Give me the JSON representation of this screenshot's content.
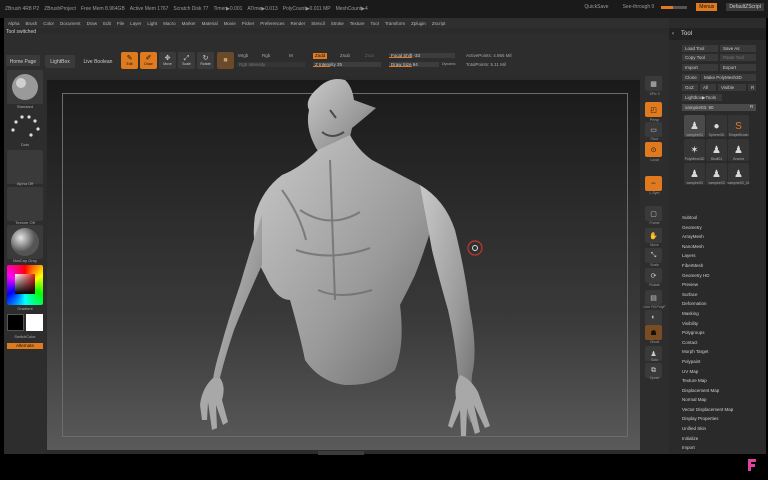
{
  "titlebar": {
    "app": "ZBrush 4R8 P2",
    "project": "ZBrushProject",
    "free_mem": "Free Mem 8.964GB",
    "active_mem": "Active Mem 1767",
    "scratch": "Scratch Disk 77",
    "timer": "Timer▶0.001",
    "atime": "ATime▶0.013",
    "polycount": "PolyCount▶0.011 MP",
    "meshcount": "MeshCount▶4"
  },
  "topright": {
    "quicksave": "QuickSave",
    "see_through": "See-through 0",
    "menus": "Menus",
    "default_zscript": "DefaultZScript"
  },
  "menubar": [
    "Alpha",
    "Brush",
    "Color",
    "Document",
    "Draw",
    "Edit",
    "File",
    "Layer",
    "Light",
    "Macro",
    "Marker",
    "Material",
    "Movie",
    "Picker",
    "Preferences",
    "Render",
    "Stencil",
    "Stroke",
    "Texture",
    "Tool",
    "Transform",
    "Zplugin",
    "Zscript"
  ],
  "status": {
    "message": "Tool switched"
  },
  "toolbar": {
    "home_page": "Home Page",
    "lightbox": "LightBox",
    "live_boolean": "Live Boolean",
    "edit": "Edit",
    "draw": "Draw",
    "move": "Move",
    "scale": "Scale",
    "rotate": "Rotate",
    "mrgb": "Mrgb",
    "rgb": "Rgb",
    "m": "M",
    "rgb_intensity": "Rgb Intensity",
    "zadd": "Zadd",
    "zsub": "Zsub",
    "zcut": "Zcut",
    "z_intensity": "Z Intensity 25",
    "focal_shift": "Focal Shift -33",
    "draw_size": "Draw Size 64",
    "dynamic": "Dynamic",
    "active_points": "ActivePoints: 4.956 Mil",
    "total_points": "TotalPoints: 5.11 Mil"
  },
  "leftpanel": {
    "standard": "Standard",
    "dots": "Dots",
    "alpha_off": "Alpha Off",
    "texture_off": "Texture Off",
    "matcap": "MatCap Gray",
    "gradient": "Gradient",
    "switch_color": "SwitchColor",
    "alternate": "Alternate"
  },
  "rightstrip": [
    "SPix 3",
    "Persp",
    "Floor",
    "Local",
    "L.Sym",
    "Frame",
    "Move",
    "Scale",
    "Rotate",
    "Line Fill PolyF",
    "Transp",
    "Ghost",
    "Solo",
    "Xpose"
  ],
  "toolpanel": {
    "title": "Tool",
    "load_tool": "Load Tool",
    "save_as": "Save As",
    "copy_tool": "Copy Tool",
    "paste_tool": "Paste Tool",
    "import": "Import",
    "export": "Export",
    "clone": "Clone",
    "make_polymesh": "Make PolyMesh3D",
    "goz": "GoZ",
    "all": "All",
    "visible": "Visible",
    "r": "R",
    "lightbox_tools": "Lightbox▶Tools",
    "current_tool": "vampire03. 90",
    "thumbs": [
      {
        "label": "vampire03",
        "glyph": "♟"
      },
      {
        "label": "Sphere3D",
        "glyph": "●"
      },
      {
        "label": "SimpleBrush",
        "glyph": "S"
      },
      {
        "label": "PolyMesh3D",
        "glyph": "✶"
      },
      {
        "label": "Skull01",
        "glyph": "♟"
      },
      {
        "label": "Gnome",
        "glyph": "♟"
      },
      {
        "label": "vampire03",
        "glyph": "♟"
      },
      {
        "label": "vampire03",
        "glyph": "♟"
      },
      {
        "label": "vampire03_01",
        "glyph": "♟"
      }
    ],
    "subpalettes": [
      "Subtool",
      "Geometry",
      "ArrayMesh",
      "NanoMesh",
      "Layers",
      "FiberMesh",
      "Geometry HD",
      "Preview",
      "Surface",
      "Deformation",
      "Masking",
      "Visibility",
      "Polygroups",
      "Contact",
      "Morph Target",
      "Polypaint",
      "UV Map",
      "Texture Map",
      "Displacement Map",
      "Normal Map",
      "Vector Displacement Map",
      "Display Properties",
      "Unified Skin",
      "Initialize",
      "Import"
    ]
  },
  "colors": {
    "accent": "#e07a1e",
    "panel": "#2d2d2d",
    "button": "#3a3a3a"
  }
}
